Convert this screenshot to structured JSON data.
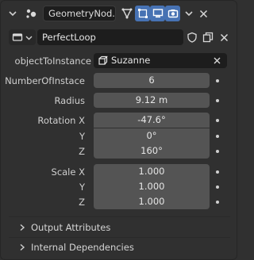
{
  "header": {
    "node_name": "GeometryNod...",
    "icons": [
      "chevron-down-icon",
      "geometry-nodes-icon",
      "edit-mode-icon",
      "realtime-icon",
      "monitor-icon",
      "camera-icon",
      "dropdown-icon",
      "close-icon"
    ]
  },
  "object": {
    "name": "PerfectLoop",
    "icons": [
      "object-type-icon",
      "shield-icon",
      "copy-icon",
      "close-icon"
    ]
  },
  "inputs": {
    "objectToInstance": {
      "label": "objectToInstance",
      "value": "Suzanne"
    },
    "number": {
      "label": "NumberOfInstace",
      "value": "6"
    },
    "radius": {
      "label": "Radius",
      "value": "9.12 m"
    },
    "rotation": {
      "label": "Rotation X",
      "label_y": "Y",
      "label_z": "Z",
      "x": "-47.6°",
      "y": "0°",
      "z": "160°"
    },
    "scale": {
      "label": "Scale X",
      "label_y": "Y",
      "label_z": "Z",
      "x": "1.000",
      "y": "1.000",
      "z": "1.000"
    }
  },
  "sections": {
    "output": "Output Attributes",
    "internal": "Internal Dependencies"
  },
  "colors": {
    "panel": "#303030",
    "field": "#545454",
    "active": "#4772b3",
    "dark_field": "#1d1d1d"
  }
}
